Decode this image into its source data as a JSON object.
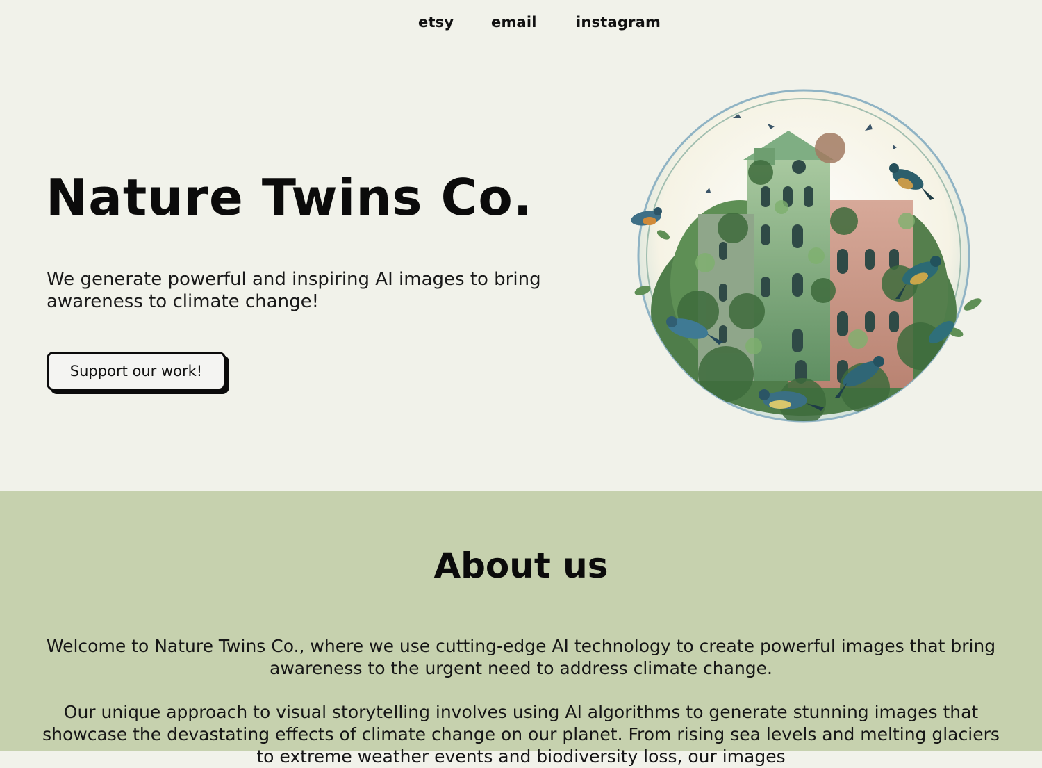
{
  "nav": {
    "items": [
      {
        "label": "etsy"
      },
      {
        "label": "email"
      },
      {
        "label": "instagram"
      }
    ]
  },
  "hero": {
    "title": "Nature Twins Co.",
    "subtitle": "We generate powerful and inspiring AI images to bring awareness to climate change!",
    "cta_label": "Support our work!",
    "image_icon": "globe-building-birds-illustration"
  },
  "about": {
    "title": "About us",
    "paragraphs": [
      "Welcome to Nature Twins Co., where we use cutting-edge AI technology to create powerful images that bring awareness to the urgent need to address climate change.",
      "Our unique approach to visual storytelling involves using AI algorithms to generate stunning images that showcase the devastating effects of climate change on our planet. From rising sea levels and melting glaciers to extreme weather events and biodiversity loss, our images"
    ]
  },
  "colors": {
    "page_bg": "#f1f2ea",
    "about_bg": "#c6d1ae",
    "text": "#0b0b0b"
  }
}
